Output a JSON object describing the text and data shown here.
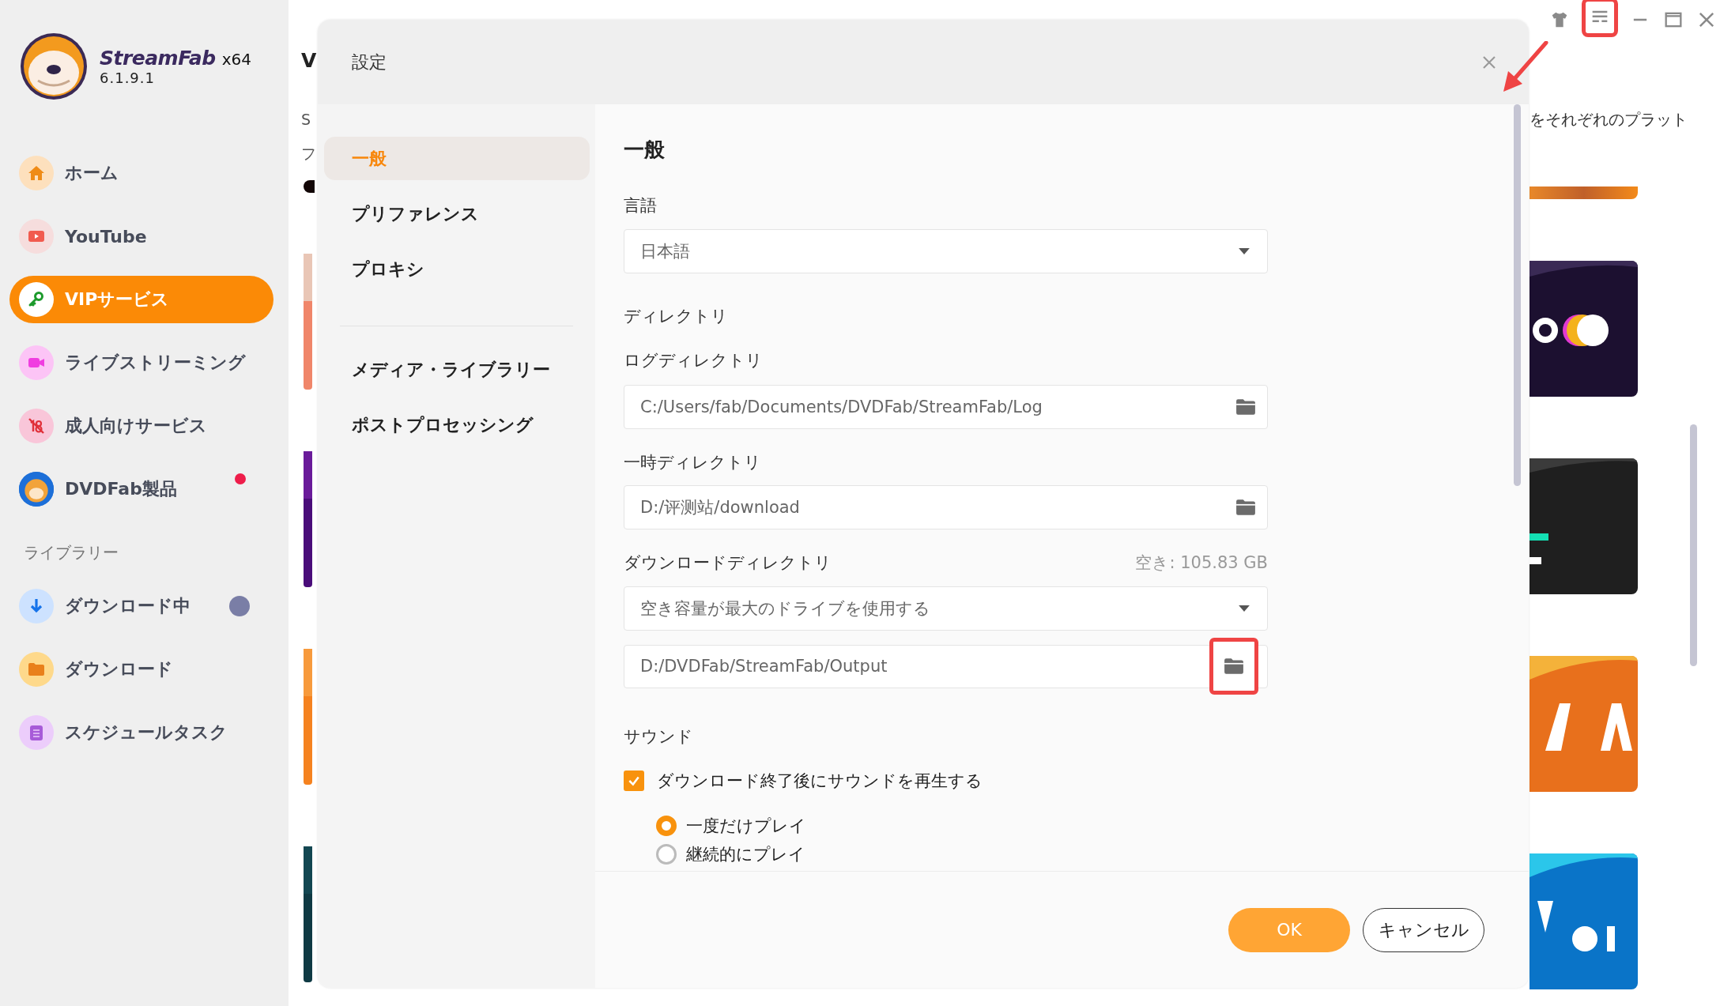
{
  "app": {
    "name": "StreamFab",
    "arch": "x64",
    "version": "6.1.9.1"
  },
  "sidebar": {
    "items": [
      {
        "label": "ホーム",
        "selected": false,
        "notification": false
      },
      {
        "label": "YouTube",
        "selected": false,
        "notification": false
      },
      {
        "label": "VIPサービス",
        "selected": true,
        "notification": false
      },
      {
        "label": "ライブストリーミング",
        "selected": false,
        "notification": false
      },
      {
        "label": "成人向けサービス",
        "selected": false,
        "notification": false
      },
      {
        "label": "DVDFab製品",
        "selected": false,
        "notification": true
      }
    ],
    "library_heading": "ライブラリー",
    "library_items": [
      {
        "label": "ダウンロード中",
        "selected": false,
        "busy": true
      },
      {
        "label": "ダウンロード",
        "selected": false,
        "busy": false
      },
      {
        "label": "スケジュールタスク",
        "selected": false,
        "busy": false
      }
    ]
  },
  "page": {
    "title_fragment": "V",
    "line_fragments": [
      "S",
      "フ"
    ],
    "right_text": "をそれぞれのプラット"
  },
  "dialog": {
    "title": "設定",
    "nav_groups": [
      {
        "items": [
          {
            "label": "一般",
            "selected": true
          },
          {
            "label": "プリファレンス",
            "selected": false
          },
          {
            "label": "プロキシ",
            "selected": false
          }
        ]
      },
      {
        "items": [
          {
            "label": "メディア・ライブラリー",
            "selected": false
          },
          {
            "label": "ポストプロセッシング",
            "selected": false
          }
        ]
      }
    ],
    "heading": "一般",
    "language": {
      "label": "言語",
      "value": "日本語"
    },
    "directory_heading": "ディレクトリ",
    "log_directory": {
      "label": "ログディレクトリ",
      "value": "C:/Users/fab/Documents/DVDFab/StreamFab/Log"
    },
    "temp_directory": {
      "label": "一時ディレクトリ",
      "value": "D:/评测站/download"
    },
    "download_directory": {
      "label": "ダウンロードディレクトリ",
      "free_space": "空き: 105.83 GB",
      "mode": "空き容量が最大のドライブを使用する",
      "value": "D:/DVDFab/StreamFab/Output"
    },
    "sound": {
      "heading": "サウンド",
      "checkbox": {
        "label": "ダウンロード終了後にサウンドを再生する",
        "checked": true
      },
      "options": [
        {
          "label": "一度だけプレイ",
          "selected": true
        },
        {
          "label": "継続的にプレイ",
          "selected": false
        }
      ]
    },
    "buttons": {
      "ok": "OK",
      "cancel": "キャンセル"
    }
  }
}
